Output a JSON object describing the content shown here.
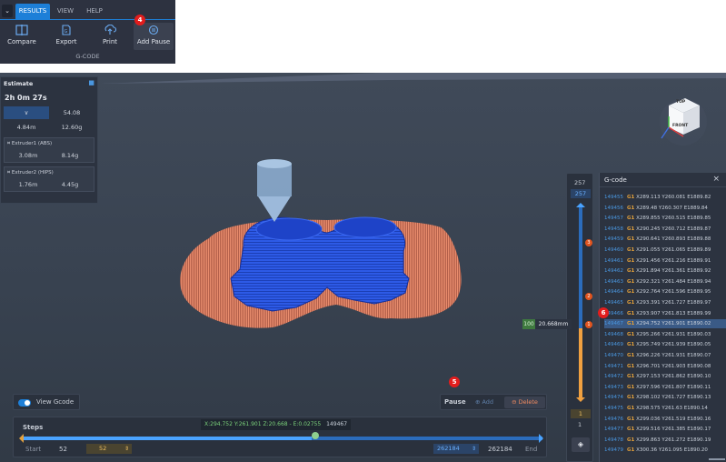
{
  "ribbon": {
    "tabs": [
      "RESULTS",
      "VIEW",
      "HELP"
    ],
    "buttons": [
      {
        "label": "Compare",
        "icon": "compare-icon"
      },
      {
        "label": "Export",
        "icon": "export-icon"
      },
      {
        "label": "Print",
        "icon": "print-icon"
      },
      {
        "label": "Add Pause",
        "icon": "add-pause-icon"
      }
    ],
    "group_label": "G-CODE"
  },
  "badges": {
    "b4": "4",
    "b5": "5",
    "b6": "6"
  },
  "estimate": {
    "title": "Estimate",
    "time": "2h 0m 27s",
    "total_drop": "∨",
    "total_value": "54.08",
    "total_length": "4.84m",
    "total_weight": "12.60g",
    "extruders": [
      {
        "name": "Extruder1 (ABS)",
        "length": "3.08m",
        "weight": "8.14g"
      },
      {
        "name": "Extruder2 (HIPS)",
        "length": "1.76m",
        "weight": "4.45g"
      }
    ]
  },
  "view_gcode_label": "View Gcode",
  "pause": {
    "label": "Pause",
    "add": "Add",
    "delete": "Delete"
  },
  "steps": {
    "label": "Steps",
    "tooltip": "X:294.752 Y:261.901 Z:20.668 - E:0.02755",
    "tooltip_line": "149467",
    "start_label": "Start",
    "start_value": "52",
    "start_input": "52",
    "end_input": "262184",
    "end_value": "262184",
    "end_label": "End",
    "position_fraction": 0.5
  },
  "layer": {
    "top": "257",
    "top_selected": "257",
    "current_tag": "100",
    "current_height": "20.668mm",
    "bottom_selected": "1",
    "bottom": "1",
    "pause_markers": [
      "3",
      "2",
      "1"
    ]
  },
  "gcode": {
    "title": "G-code",
    "close": "×",
    "lines": [
      {
        "n": "149455",
        "cmd": "G1",
        "text": "X289.113 Y260.081 E1889.82"
      },
      {
        "n": "149456",
        "cmd": "G1",
        "text": "X289.48 Y260.307 E1889.84"
      },
      {
        "n": "149457",
        "cmd": "G1",
        "text": "X289.855 Y260.515 E1889.85"
      },
      {
        "n": "149458",
        "cmd": "G1",
        "text": "X290.245 Y260.712 E1889.87"
      },
      {
        "n": "149459",
        "cmd": "G1",
        "text": "X290.641 Y260.893 E1889.88"
      },
      {
        "n": "149460",
        "cmd": "G1",
        "text": "X291.055 Y261.065 E1889.89"
      },
      {
        "n": "149461",
        "cmd": "G1",
        "text": "X291.456 Y261.216 E1889.91"
      },
      {
        "n": "149462",
        "cmd": "G1",
        "text": "X291.894 Y261.361 E1889.92"
      },
      {
        "n": "149463",
        "cmd": "G1",
        "text": "X292.321 Y261.484 E1889.94"
      },
      {
        "n": "149464",
        "cmd": "G1",
        "text": "X292.764 Y261.596 E1889.95"
      },
      {
        "n": "149465",
        "cmd": "G1",
        "text": "X293.391 Y261.727 E1889.97"
      },
      {
        "n": "149466",
        "cmd": "G1",
        "text": "X293.907 Y261.813 E1889.99"
      },
      {
        "n": "149467",
        "cmd": "G1",
        "text": "X294.752 Y261.901 E1890.02"
      },
      {
        "n": "149468",
        "cmd": "G1",
        "text": "X295.266 Y261.931 E1890.03"
      },
      {
        "n": "149469",
        "cmd": "G1",
        "text": "X295.749 Y261.939 E1890.05"
      },
      {
        "n": "149470",
        "cmd": "G1",
        "text": "X296.226 Y261.931 E1890.07"
      },
      {
        "n": "149471",
        "cmd": "G1",
        "text": "X296.701 Y261.903 E1890.08"
      },
      {
        "n": "149472",
        "cmd": "G1",
        "text": "X297.153 Y261.862 E1890.10"
      },
      {
        "n": "149473",
        "cmd": "G1",
        "text": "X297.596 Y261.807 E1890.11"
      },
      {
        "n": "149474",
        "cmd": "G1",
        "text": "X298.102 Y261.727 E1890.13"
      },
      {
        "n": "149475",
        "cmd": "G1",
        "text": "X298.575 Y261.63 E1890.14"
      },
      {
        "n": "149476",
        "cmd": "G1",
        "text": "X299.036 Y261.519 E1890.16"
      },
      {
        "n": "149477",
        "cmd": "G1",
        "text": "X299.516 Y261.385 E1890.17"
      },
      {
        "n": "149478",
        "cmd": "G1",
        "text": "X299.863 Y261.272 E1890.19"
      },
      {
        "n": "149479",
        "cmd": "G1",
        "text": "X300.36 Y261.095 E1890.20"
      }
    ],
    "current_index": 12
  },
  "navcube": {
    "top": "TOP",
    "front": "FRONT"
  },
  "colors": {
    "accent": "#1d7fd8",
    "model": "#2a55e0",
    "raft": "#e58a6c",
    "pause_marker": "#e0541f",
    "current_line": "#3a5a86"
  }
}
